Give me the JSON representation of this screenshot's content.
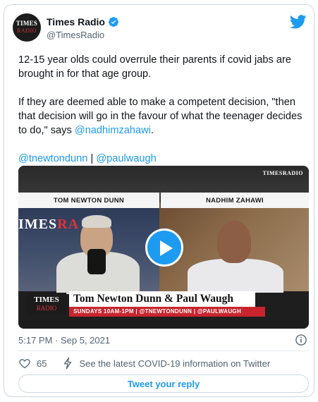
{
  "account": {
    "display_name": "Times Radio",
    "handle": "@TimesRadio",
    "avatar_text_top": "TIMES",
    "avatar_text_bottom": "RADIO"
  },
  "tweet": {
    "para1": "12-15 year olds could overrule their parents if covid jabs are brought in for that age group.",
    "para2_lead": "If they are deemed able to make a competent decision, \"then that decision will go in the favour of what the teenager decides to do,\" says ",
    "para2_mention": "@nadhimzahawi",
    "para2_end": ".",
    "mention_a": "@tnewtondunn",
    "separator": " | ",
    "mention_b": "@paulwaugh"
  },
  "video": {
    "top_brand": "TIMESRADIO",
    "label_left": "TOM NEWTON DUNN",
    "label_right": "NADHIM ZAHAWI",
    "wall_text_main": "IMES",
    "wall_text_accent": "RA",
    "lower_logo_top": "TIMES",
    "lower_logo_bottom": "RADIO",
    "lower_name": "Tom Newton Dunn & Paul Waugh",
    "lower_schedule": "SUNDAYS 10AM-1PM | @TNEWTONDUNN | @PAULWAUGH"
  },
  "meta": {
    "timestamp": "5:17 PM · Sep 5, 2021",
    "likes": "65",
    "covid_link": "See the latest COVID-19 information on Twitter",
    "reply_button": "Tweet your reply"
  },
  "colors": {
    "accent": "#1d9bf0",
    "muted": "#536471",
    "border": "#cfd9de",
    "brand_red": "#e0313b"
  }
}
